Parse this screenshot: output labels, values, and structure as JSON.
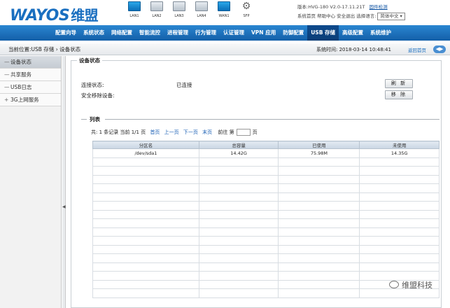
{
  "header": {
    "logo_text": "WAYOS",
    "logo_cn": "维盟",
    "ports": [
      {
        "label": "LAN1",
        "active": true
      },
      {
        "label": "LAN2",
        "active": false
      },
      {
        "label": "LAN3",
        "active": false
      },
      {
        "label": "LAN4",
        "active": false
      },
      {
        "label": "WAN1",
        "active": true
      },
      {
        "label": "SFP",
        "active": false
      }
    ],
    "version_text": "版本:HVG-180 V2.0-17.11.21T",
    "upgrade_link": "固件检测",
    "links_text": "系统首页  帮助中心  安全退出  选择语言:",
    "language": "简体中文 ▾"
  },
  "nav": {
    "items": [
      "配置向导",
      "系统状态",
      "网络配置",
      "智能流控",
      "进程管理",
      "行为管理",
      "认证管理",
      "VPN 应用",
      "防御配置",
      "USB 存储",
      "高级配置",
      "系统维护"
    ],
    "active_index": 9
  },
  "breadcrumb": {
    "path": "当前位置:USB 存储  ›  设备状态",
    "system_time": "系统时间: 2018-03-14 10:48:41",
    "home_link": "返回首页"
  },
  "sidebar": {
    "items": [
      {
        "symbol": "—",
        "label": "设备状态",
        "active": true
      },
      {
        "symbol": "—",
        "label": "共享服务",
        "active": false
      },
      {
        "symbol": "—",
        "label": "USB日志",
        "active": false
      },
      {
        "symbol": "+",
        "label": "3G上网服务",
        "active": false
      }
    ]
  },
  "device_status": {
    "legend": "设备状态",
    "connection_label": "连接状态:",
    "connection_value": "已连接",
    "safe_remove_label": "安全移除设备:",
    "refresh_button": "刷 新",
    "remove_button": "移 除"
  },
  "list": {
    "title": "列表",
    "pager_prefix": "共: 1 条记录  当前 1/1 页",
    "first": "首页",
    "prev": "上一页",
    "next": "下一页",
    "last": "末页",
    "goto_label": "前往 第",
    "goto_suffix": "页",
    "columns": [
      "分区名",
      "总容量",
      "已使用",
      "未使用"
    ],
    "rows": [
      [
        "/dev/sda1",
        "14.42G",
        "75.98M",
        "14.35G"
      ]
    ],
    "empty_rows": 16
  },
  "watermark": "维盟科技"
}
